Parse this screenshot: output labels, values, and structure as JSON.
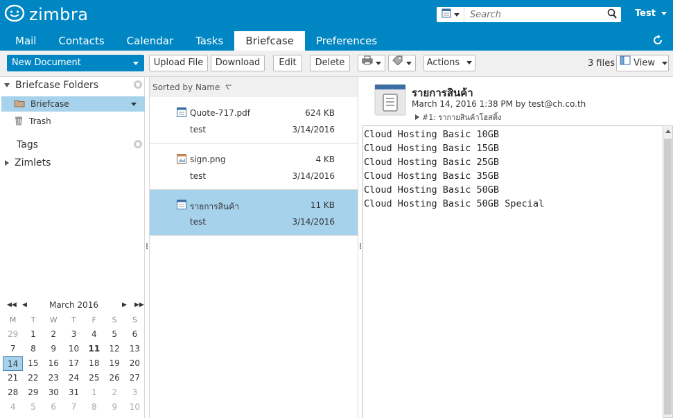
{
  "app": {
    "brand": "zimbra"
  },
  "search": {
    "placeholder": "Search"
  },
  "user": {
    "name": "Test"
  },
  "tabs": [
    {
      "label": "Mail"
    },
    {
      "label": "Contacts"
    },
    {
      "label": "Calendar"
    },
    {
      "label": "Tasks"
    },
    {
      "label": "Briefcase"
    },
    {
      "label": "Preferences"
    }
  ],
  "toolbar": {
    "new_document": "New Document",
    "upload_file": "Upload File",
    "download": "Download",
    "edit": "Edit",
    "delete": "Delete",
    "actions": "Actions",
    "file_count": "3 files",
    "view": "View"
  },
  "sidebar": {
    "folders_header": "Briefcase Folders",
    "folders": [
      {
        "label": "Briefcase"
      },
      {
        "label": "Trash"
      }
    ],
    "tags_header": "Tags",
    "zimlets_header": "Zimlets"
  },
  "calendar": {
    "month": "March 2016",
    "dow": [
      "M",
      "T",
      "W",
      "T",
      "F",
      "S",
      "S"
    ],
    "weeks": [
      [
        "29",
        "1",
        "2",
        "3",
        "4",
        "5",
        "6"
      ],
      [
        "7",
        "8",
        "9",
        "10",
        "11",
        "12",
        "13"
      ],
      [
        "14",
        "15",
        "16",
        "17",
        "18",
        "19",
        "20"
      ],
      [
        "21",
        "22",
        "23",
        "24",
        "25",
        "26",
        "27"
      ],
      [
        "28",
        "29",
        "30",
        "31",
        "1",
        "2",
        "3"
      ],
      [
        "4",
        "5",
        "6",
        "7",
        "8",
        "9",
        "10"
      ]
    ]
  },
  "list": {
    "sort_label": "Sorted by Name",
    "items": [
      {
        "name": "Quote-717.pdf",
        "size": "624 KB",
        "owner": "test",
        "date": "3/14/2016"
      },
      {
        "name": "sign.png",
        "size": "4 KB",
        "owner": "test",
        "date": "3/14/2016"
      },
      {
        "name": "รายการสินค้า",
        "size": "11 KB",
        "owner": "test",
        "date": "3/14/2016"
      }
    ]
  },
  "preview": {
    "title": "รายการสินค้า",
    "meta": "March 14, 2016 1:38 PM by test@ch.co.th",
    "version": "#1: รากายสินค้าโฮสติ้ง",
    "lines": [
      "Cloud Hosting Basic 10GB",
      "Cloud Hosting Basic 15GB",
      "Cloud Hosting Basic 25GB",
      "Cloud Hosting Basic 35GB",
      "Cloud Hosting Basic 50GB",
      "Cloud Hosting Basic 50GB Special"
    ]
  },
  "colors": {
    "brand": "#0087c3",
    "selection": "#a7d2ec",
    "toolbar_bg": "#f0f0f0"
  },
  "icons": [
    "zimbra-logo-icon",
    "search-type-icon",
    "search-icon",
    "refresh-icon",
    "print-icon",
    "tag-icon",
    "view-icon",
    "gear-icon",
    "folder-icon",
    "trash-icon",
    "document-icon",
    "pdf-icon",
    "image-icon"
  ]
}
